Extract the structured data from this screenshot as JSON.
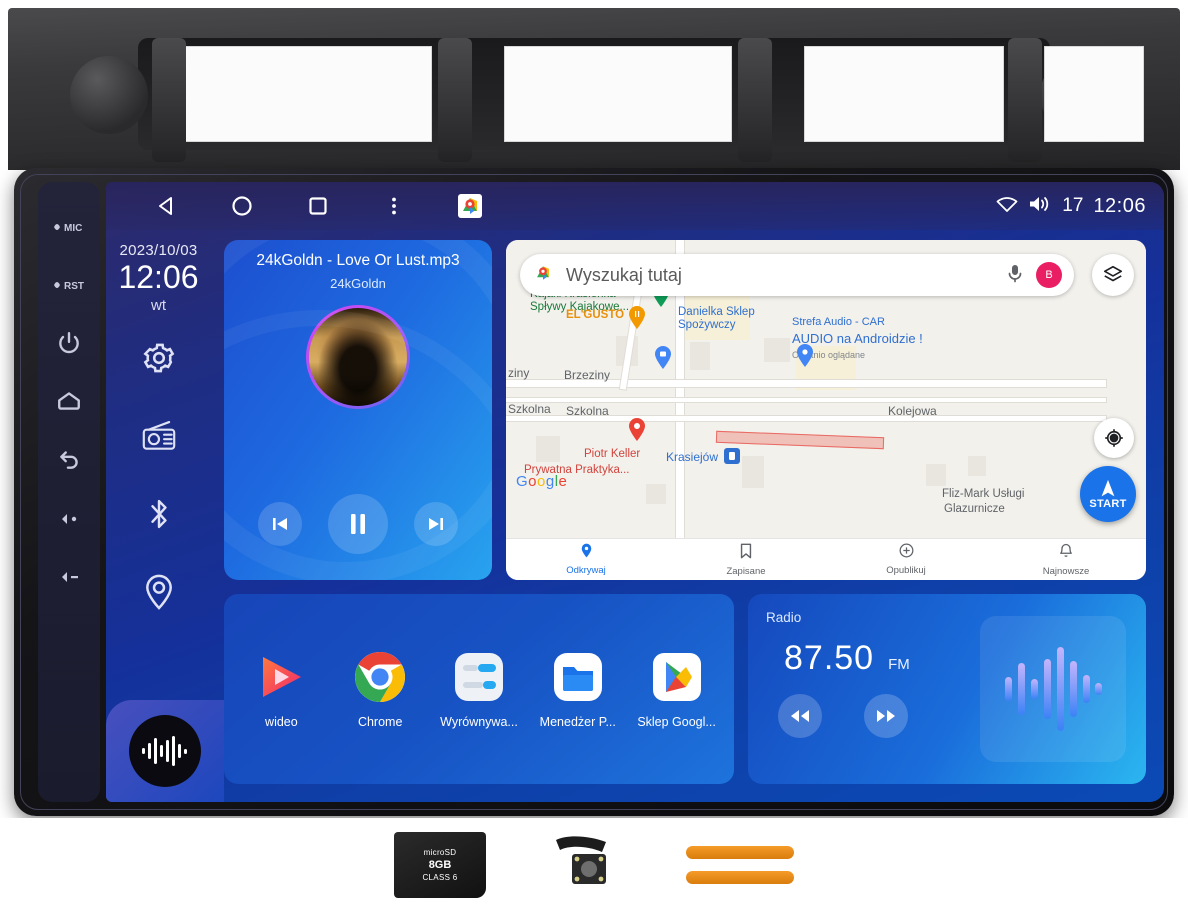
{
  "statusbar": {
    "nav": [
      {
        "name": "back-icon",
        "label": "back"
      },
      {
        "name": "home-icon",
        "label": "home"
      },
      {
        "name": "recents-icon",
        "label": "recents"
      },
      {
        "name": "overflow-menu-icon",
        "label": "menu"
      },
      {
        "name": "maps-shortcut-icon",
        "label": "Maps"
      }
    ],
    "wifi_icon": "wifi-icon",
    "volume_icon": "volume-icon",
    "volume_level": "17",
    "clock": "12:06"
  },
  "rail": {
    "date": "2023/10/03",
    "time": "12:06",
    "day": "wt",
    "icons": [
      {
        "name": "settings-gear-icon",
        "label": "Settings"
      },
      {
        "name": "radio-icon",
        "label": "Radio"
      },
      {
        "name": "bluetooth-icon",
        "label": "Bluetooth"
      },
      {
        "name": "location-pin-icon",
        "label": "Navigation"
      }
    ],
    "visualizer_label": "Music visualizer"
  },
  "hardware_buttons": [
    {
      "name": "mic-button",
      "label": "MIC"
    },
    {
      "name": "reset-button",
      "label": "RST"
    },
    {
      "name": "power-button",
      "label": "Power"
    },
    {
      "name": "home-button",
      "label": "Home"
    },
    {
      "name": "back-button",
      "label": "Back"
    },
    {
      "name": "volume-up-button",
      "label": "Vol +"
    },
    {
      "name": "volume-down-button",
      "label": "Vol -"
    }
  ],
  "music": {
    "title": "24kGoldn - Love Or Lust.mp3",
    "artist": "24kGoldn",
    "prev_label": "Previous",
    "play_label": "Pause",
    "next_label": "Next"
  },
  "map": {
    "search_placeholder": "Wyszukaj tutaj",
    "avatar_initial": "B",
    "mic_icon": "microphone-icon",
    "layers_icon": "layers-icon",
    "locate_icon": "locate-me-icon",
    "start_label": "START",
    "attribution": "Google",
    "pois": [
      {
        "text": "Kajaki Krasieńka -\nSpływy Kajakowe...",
        "color": "green"
      },
      {
        "text": "Danielka Sklep\nSpożywczy",
        "color": "blue"
      },
      {
        "text": "Strefa Audio - CAR",
        "color": "blue"
      },
      {
        "text": "AUDIO na Androidzie !",
        "color": "blue"
      },
      {
        "text": "Ostatnio oglądane",
        "color": "sub"
      },
      {
        "text": "EL'GUSTO",
        "color": "orange"
      },
      {
        "text": "Piotr Keller",
        "color": "red"
      },
      {
        "text": "Prywatna Praktyka...",
        "color": "red"
      },
      {
        "text": "Fliz-Mark Usługi",
        "color": "grey"
      },
      {
        "text": "Glazurnicze",
        "color": "grey"
      },
      {
        "text": "Krasiejów",
        "color": "blue"
      }
    ],
    "roads": [
      "Brzeziny",
      "ziny",
      "Szkolna",
      "Szkolna",
      "Kolejowa"
    ],
    "bottom_nav": [
      {
        "label": "Odkrywaj",
        "icon": "explore-pin-icon",
        "active": true
      },
      {
        "label": "Zapisane",
        "icon": "bookmark-icon",
        "active": false
      },
      {
        "label": "Opublikuj",
        "icon": "contribute-icon",
        "active": false
      },
      {
        "label": "Najnowsze",
        "icon": "bell-icon",
        "active": false
      }
    ]
  },
  "apps": [
    {
      "label": "wideo",
      "icon": "video-player-icon"
    },
    {
      "label": "Chrome",
      "icon": "chrome-icon"
    },
    {
      "label": "Wyrównywa...",
      "icon": "equalizer-icon"
    },
    {
      "label": "Menedżer P...",
      "icon": "file-manager-icon"
    },
    {
      "label": "Sklep Googl...",
      "icon": "play-store-icon"
    }
  ],
  "radio": {
    "title": "Radio",
    "frequency": "87.50",
    "band": "FM",
    "prev_label": "Seek down",
    "next_label": "Seek up",
    "visualizer_label": "Radio visualizer"
  },
  "accessories": [
    {
      "name": "microsd-card",
      "top_text": "microSD",
      "capacity": "8GB",
      "class_text": "CLASS 6"
    },
    {
      "name": "rear-camera",
      "label": "Rear view camera"
    },
    {
      "name": "pry-tools",
      "label": "Trim removal tools"
    }
  ],
  "colors": {
    "screen_blue": "#15309a",
    "accent_blue": "#1a73e8",
    "card_blue": "#1e73dc",
    "pink_avatar": "#e91e63"
  }
}
